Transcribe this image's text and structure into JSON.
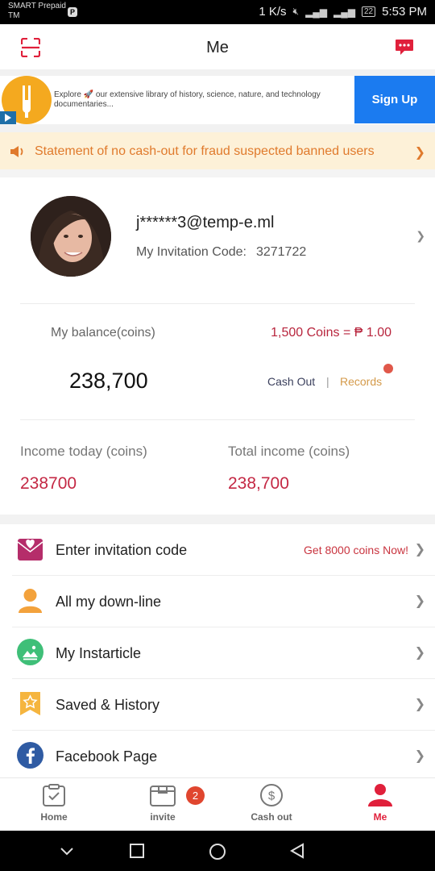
{
  "status_bar": {
    "carrier": "SMART Prepaid\nTM",
    "carrier_line1": "SMART Prepaid",
    "carrier_line2": "TM",
    "network_speed": "1 K/s",
    "battery": "22",
    "time": "5:53 PM"
  },
  "header": {
    "title": "Me"
  },
  "ad": {
    "text": "Explore 🚀 our extensive library of history, science, nature, and technology documentaries...",
    "button_label": "Sign Up"
  },
  "notice": {
    "text": "Statement of no cash-out for fraud suspected banned users"
  },
  "profile": {
    "email": "j******3@temp-e.ml",
    "invitation_label": "My Invitation Code:",
    "invitation_code": "3271722"
  },
  "balance": {
    "label": "My balance(coins)",
    "rate": "1,500 Coins = ₱ 1.00",
    "value": "238,700",
    "cash_out_label": "Cash Out",
    "separator": "|",
    "records_label": "Records"
  },
  "income": {
    "today_label": "Income today (coins)",
    "today_value": "238700",
    "total_label": "Total income (coins)",
    "total_value": "238,700"
  },
  "menu": [
    {
      "label": "Enter invitation code",
      "promo": "Get 8000 coins Now!",
      "icon": "invitation-heart-icon",
      "color": "#b52d6a"
    },
    {
      "label": "All my down-line",
      "icon": "person-icon",
      "color": "#f3a23c"
    },
    {
      "label": "My Instarticle",
      "icon": "image-icon",
      "color": "#3fbf78"
    },
    {
      "label": "Saved & History",
      "icon": "star-bookmark-icon",
      "color": "#f5b53f"
    },
    {
      "label": "Facebook Page",
      "icon": "facebook-icon",
      "color": "#2f5ba3"
    }
  ],
  "bottom_nav": {
    "items": [
      {
        "label": "Home",
        "icon": "home-clipboard-icon"
      },
      {
        "label": "invite",
        "icon": "invite-box-icon",
        "badge": "2"
      },
      {
        "label": "Cash out",
        "icon": "dollar-coin-icon"
      },
      {
        "label": "Me",
        "icon": "person-icon",
        "active": true
      }
    ]
  },
  "colors": {
    "accent_red": "#e0203b",
    "notice_bg": "#fdf1d8",
    "notice_text": "#e07a2c",
    "income_red": "#c42844",
    "ad_button": "#1b7bf0"
  }
}
